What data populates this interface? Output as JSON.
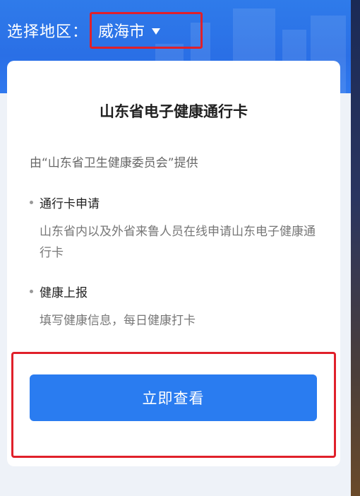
{
  "header": {
    "region_label": "选择地区：",
    "selected_region": "威海市",
    "caret_icon": "caret-down-icon"
  },
  "card": {
    "title": "山东省电子健康通行卡",
    "provider": "由“山东省卫生健康委员会”提供",
    "items": [
      {
        "heading": "通行卡申请",
        "description": "山东省内以及外省来鲁人员在线申请山东电子健康通行卡"
      },
      {
        "heading": "健康上报",
        "description": "填写健康信息，每日健康打卡"
      }
    ],
    "view_button_label": "立即查看"
  },
  "colors": {
    "header_blue": "#2a6fe6",
    "button_blue": "#2a7cf0",
    "highlight_red": "#e0202a"
  }
}
